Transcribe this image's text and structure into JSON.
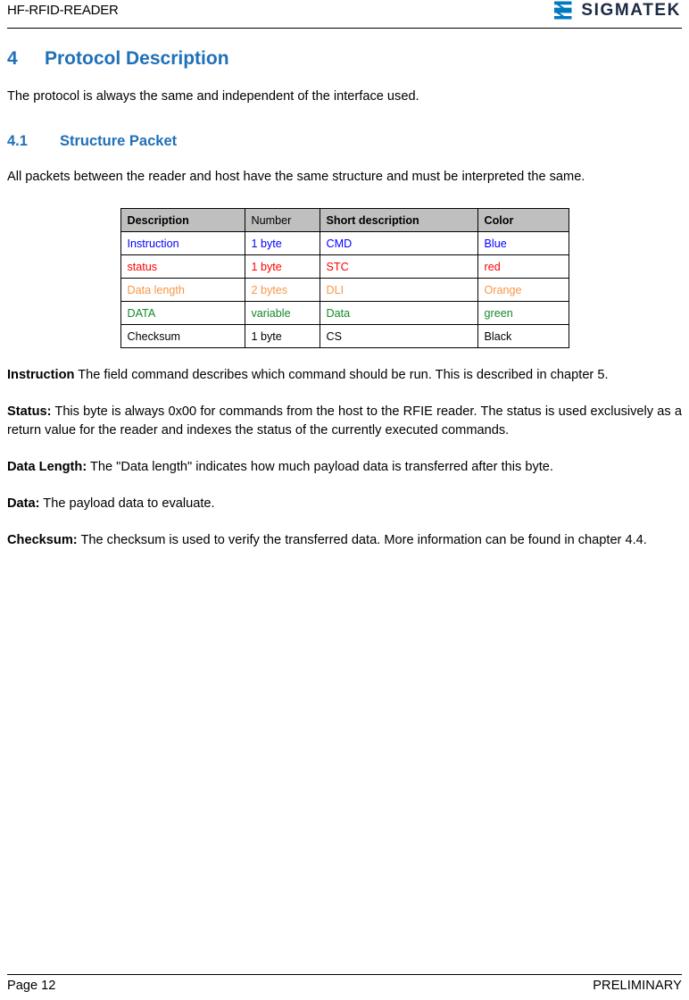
{
  "header": {
    "document_title": "HF-RFID-READER",
    "brand_name": "SIGMATEK",
    "brand_mark_icon": "sigmatek-sigma-logo-icon",
    "brand_mark_color": "#0079c1"
  },
  "section": {
    "number": "4",
    "title": "Protocol Description",
    "intro": "The protocol is always the same and independent of the interface used.",
    "heading_color": "#1f70b8"
  },
  "subsection": {
    "number": "4.1",
    "title": "Structure Packet",
    "intro": "All packets between the reader and host have the same structure and must be interpreted the same."
  },
  "table": {
    "headers": [
      {
        "label": "Description",
        "bold": true
      },
      {
        "label": "Number",
        "bold": false
      },
      {
        "label": "Short description",
        "bold": true
      },
      {
        "label": "Color",
        "bold": true
      }
    ],
    "header_background": "#bfbfbf",
    "rows": [
      {
        "description": "Instruction",
        "number": "1 byte",
        "short_description": "CMD",
        "color_name": "Blue",
        "row_color": "#0000ff"
      },
      {
        "description": "status",
        "number": "1 byte",
        "short_description": "STC",
        "color_name": "red",
        "row_color": "#ff0000"
      },
      {
        "description": "Data length",
        "number": "2 bytes",
        "short_description": "DLI",
        "color_name": "Orange",
        "row_color": "#f79646"
      },
      {
        "description": "DATA",
        "number": "variable",
        "short_description": "Data",
        "color_name": "green",
        "row_color": "#128a2a"
      },
      {
        "description": "Checksum",
        "number": "1 byte",
        "short_description": "CS",
        "color_name": "Black",
        "row_color": "#000000"
      }
    ]
  },
  "definitions": [
    {
      "term": "Instruction",
      "text": " The field command describes which command should be run. This is described in chapter 5."
    },
    {
      "term": "Status:",
      "text": " This byte is always 0x00 for commands from the host to the RFIE reader. The status is used exclusively as a return value for the reader and indexes the status of the currently executed commands."
    },
    {
      "term": "Data Length:",
      "text": " The \"Data length\" indicates how much payload data is transferred after this byte."
    },
    {
      "term": "Data:",
      "text": " The payload data to evaluate."
    },
    {
      "term": "Checksum:",
      "text": " The checksum is used to verify the transferred data. More information can be found in chapter 4.4."
    }
  ],
  "footer": {
    "page_label": "Page 12",
    "status_label": "PRELIMINARY"
  }
}
